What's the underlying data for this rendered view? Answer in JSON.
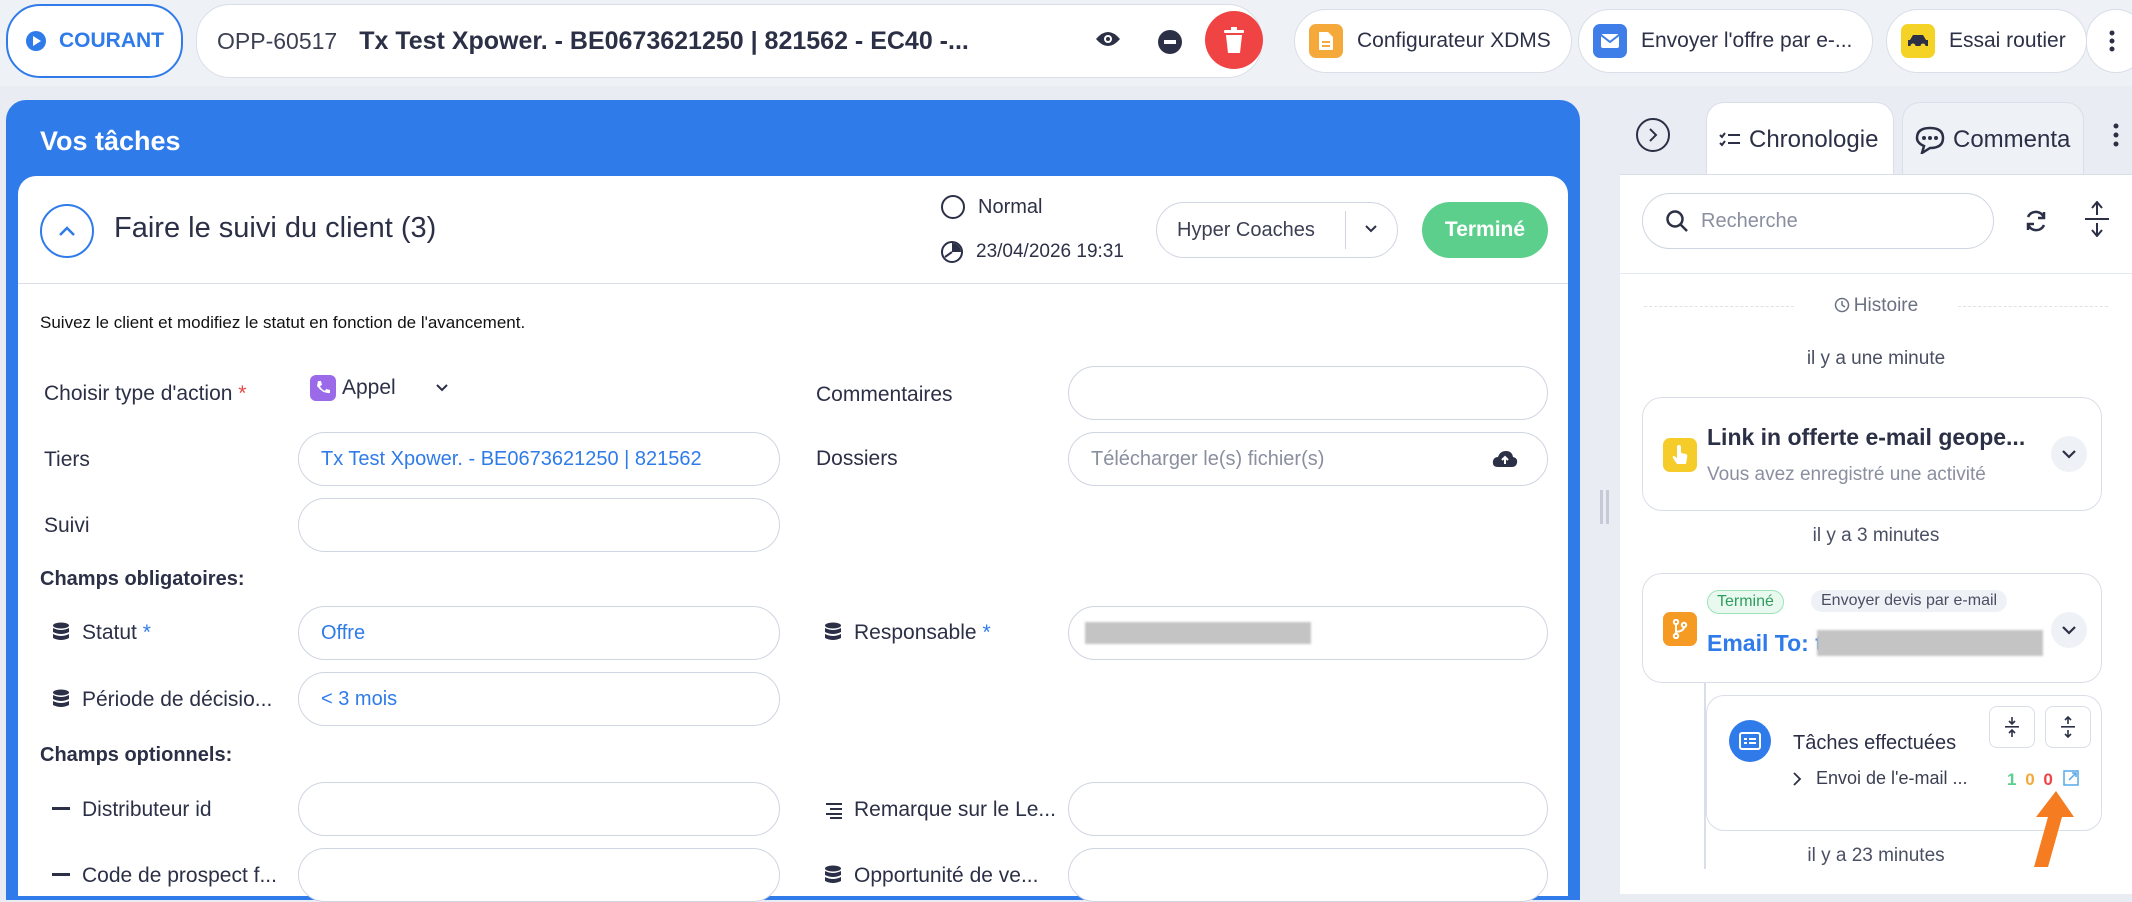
{
  "topbar": {
    "status_label": "COURANT",
    "opp_id": "OPP-60517",
    "opp_title": "Tx Test Xpower. - BE0673621250 | 821562 - EC40 -...",
    "actions": [
      {
        "label": "Configurateur XDMS",
        "icon": "document-icon",
        "color": "#f4a93a"
      },
      {
        "label": "Envoyer l'offre par e-...",
        "icon": "mail-icon",
        "color": "#3f7ee8"
      },
      {
        "label": "Essai routier",
        "icon": "car-icon",
        "color": "#f5d326"
      }
    ]
  },
  "tasks": {
    "header": "Vos tâches",
    "task_title": "Faire le suivi du client (3)",
    "priority": "Normal",
    "due_date": "23/04/2026 19:31",
    "assignee": "Hyper Coaches",
    "done_label": "Terminé",
    "description": "Suivez le client et modifiez le statut en fonction de l'avancement.",
    "labels": {
      "action_type": "Choisir type d'action",
      "comments": "Commentaires",
      "tiers": "Tiers",
      "dossiers": "Dossiers",
      "suivi": "Suivi",
      "required_section": "Champs obligatoires:",
      "statut": "Statut",
      "responsable": "Responsable",
      "periode": "Période de décisio...",
      "optional_section": "Champs optionnels:",
      "distributeur": "Distributeur id",
      "remarque": "Remarque sur le Le...",
      "code_prospect": "Code de prospect f...",
      "opportunite": "Opportunité de ve..."
    },
    "values": {
      "action_type": "Appel",
      "tiers": "Tx Test Xpower. - BE0673621250 | 821562",
      "dossiers_placeholder": "Télécharger le(s) fichier(s)",
      "statut": "Offre",
      "periode": "< 3 mois"
    },
    "required_mark": "*"
  },
  "timeline": {
    "tabs": [
      "Chronologie",
      "Commenta"
    ],
    "search_placeholder": "Recherche",
    "history_label": "Histoire",
    "entries": [
      {
        "time": "il y a une minute",
        "title": "Link in offerte e-mail geope...",
        "subtitle": "Vous avez enregistré une activité"
      },
      {
        "time": "il y a 3 minutes",
        "badge": "Terminé",
        "tag": "Envoyer devis par e-mail",
        "title": "Email To: t"
      }
    ],
    "subcard": {
      "title": "Tâches effectuées",
      "item": "Envoi de l'e-mail ...",
      "counts": [
        "1",
        "0",
        "0"
      ]
    },
    "last_time": "il y a 23 minutes"
  },
  "colors": {
    "accent": "#2f7bea",
    "success": "#5ccf8d",
    "danger": "#f04444",
    "arrow": "#f57c20"
  }
}
